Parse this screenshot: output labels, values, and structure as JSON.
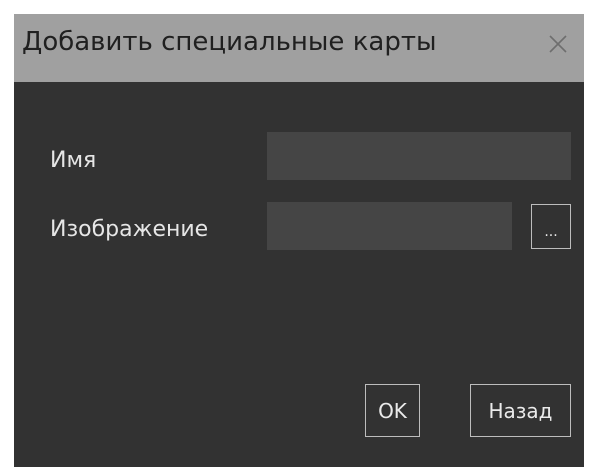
{
  "window": {
    "title": "Добавить специальные карты",
    "close_icon": "close-icon"
  },
  "form": {
    "name_label": "Имя",
    "name_value": "",
    "image_label": "Изображение",
    "image_value": "",
    "browse_label": "..."
  },
  "footer": {
    "ok_label": "OK",
    "back_label": "Назад"
  },
  "colors": {
    "titlebar": "#a0a0a0",
    "background": "#323232",
    "field": "#454545",
    "text": "#e6e6e6"
  }
}
